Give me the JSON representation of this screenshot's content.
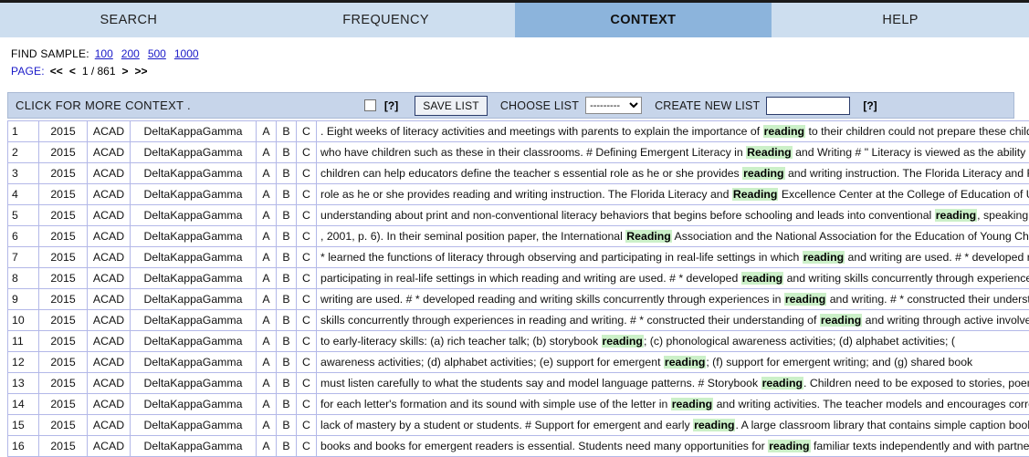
{
  "tabs": [
    {
      "label": "SEARCH",
      "active": false
    },
    {
      "label": "FREQUENCY",
      "active": false
    },
    {
      "label": "CONTEXT",
      "active": true
    },
    {
      "label": "HELP",
      "active": false
    }
  ],
  "nav": {
    "find_sample_label": "FIND SAMPLE:",
    "sample_links": [
      "100",
      "200",
      "500",
      "1000"
    ],
    "page_label": "PAGE:",
    "first_arrow": "<<",
    "prev_arrow": "<",
    "page_indicator": "1 / 861",
    "next_arrow": ">",
    "last_arrow": ">>"
  },
  "toolbar": {
    "title": "CLICK FOR MORE CONTEXT .",
    "checkbox_checked": false,
    "help_icon_1": "[?]",
    "save_list_label": "SAVE LIST",
    "choose_list_label": "CHOOSE LIST",
    "choose_list_value": "---------",
    "choose_list_options": [
      "---------"
    ],
    "create_new_list_label": "CREATE NEW LIST",
    "create_new_list_value": "",
    "create_new_list_placeholder": "",
    "help_icon_2": "[?]"
  },
  "colors": {
    "tab_inactive": "#cddeef",
    "tab_active": "#8cb4dc",
    "toolbar_bg": "#c7d5ea",
    "table_border": "#b3b8e8",
    "keyword_highlight": "#cbf0c8",
    "link_blue": "#1919c8"
  },
  "table": {
    "col_a_label": "A",
    "col_b_label": "B",
    "col_c_label": "C",
    "rows": [
      {
        "num": "1",
        "year": "2015",
        "genre": "ACAD",
        "source": "DeltaKappaGamma",
        "pre": ". Eight weeks of literacy activities and meetings with parents to explain the importance of ",
        "kw": "reading",
        "post": " to their children could not prepare these children for the complexities of the"
      },
      {
        "num": "2",
        "year": "2015",
        "genre": "ACAD",
        "source": "DeltaKappaGamma",
        "pre": "who have children such as these in their classrooms. # Defining Emergent Literacy in ",
        "kw": "Reading",
        "post": " and Writing # \" Literacy is viewed as the ability of individuals to construct meaning"
      },
      {
        "num": "3",
        "year": "2015",
        "genre": "ACAD",
        "source": "DeltaKappaGamma",
        "pre": "children can help educators define the teacher s essential role as he or she provides ",
        "kw": "reading",
        "post": " and writing instruction. The Florida Literacy and Reading Excellence Center at the"
      },
      {
        "num": "4",
        "year": "2015",
        "genre": "ACAD",
        "source": "DeltaKappaGamma",
        "pre": "role as he or she provides reading and writing instruction. The Florida Literacy and ",
        "kw": "Reading",
        "post": " Excellence Center at the College of Education of University of Central Florida"
      },
      {
        "num": "5",
        "year": "2015",
        "genre": "ACAD",
        "source": "DeltaKappaGamma",
        "pre": "understanding about print and non-conventional literacy behaviors that begins before schooling and leads into conventional ",
        "kw": "reading",
        "post": ", speaking, viewing, and the understanding of"
      },
      {
        "num": "6",
        "year": "2015",
        "genre": "ACAD",
        "source": "DeltaKappaGamma",
        "pre": ", 2001, p. 6). In their seminal position paper, the International ",
        "kw": "Reading",
        "post": " Association and the National Association for the Education of Young Children concluded that"
      },
      {
        "num": "7",
        "year": "2015",
        "genre": "ACAD",
        "source": "DeltaKappaGamma",
        "pre": "* learned the functions of literacy through observing and participating in real-life settings in which ",
        "kw": "reading",
        "post": " and writing are used. # * developed reading and writing skills"
      },
      {
        "num": "8",
        "year": "2015",
        "genre": "ACAD",
        "source": "DeltaKappaGamma",
        "pre": "participating in real-life settings in which reading and writing are used. # * developed ",
        "kw": "reading",
        "post": " and writing skills concurrently through experiences in reading and writing. # *"
      },
      {
        "num": "9",
        "year": "2015",
        "genre": "ACAD",
        "source": "DeltaKappaGamma",
        "pre": "writing are used. # * developed reading and writing skills concurrently through experiences in ",
        "kw": "reading",
        "post": " and writing. # * constructed their understanding of reading and writing"
      },
      {
        "num": "10",
        "year": "2015",
        "genre": "ACAD",
        "source": "DeltaKappaGamma",
        "pre": "skills concurrently through experiences in reading and writing. # * constructed their understanding of ",
        "kw": "reading",
        "post": " and writing through active involvement in various literacy"
      },
      {
        "num": "11",
        "year": "2015",
        "genre": "ACAD",
        "source": "DeltaKappaGamma",
        "pre": "to early-literacy skills: (a) rich teacher talk; (b) storybook ",
        "kw": "reading",
        "post": "; (c) phonological awareness activities; (d) alphabet activities; ("
      },
      {
        "num": "12",
        "year": "2015",
        "genre": "ACAD",
        "source": "DeltaKappaGamma",
        "pre": "awareness activities; (d) alphabet activities; (e) support for emergent ",
        "kw": "reading",
        "post": "; (f) support for emergent writing; and (g) shared book"
      },
      {
        "num": "13",
        "year": "2015",
        "genre": "ACAD",
        "source": "DeltaKappaGamma",
        "pre": "must listen carefully to what the students say and model language patterns. # Storybook ",
        "kw": "reading",
        "post": ". Children need to be exposed to stories, poems, and expository text"
      },
      {
        "num": "14",
        "year": "2015",
        "genre": "ACAD",
        "source": "DeltaKappaGamma",
        "pre": "for each letter's formation and its sound with simple use of the letter in ",
        "kw": "reading",
        "post": " and writing activities. The teacher models and encourages correct formation of letters"
      },
      {
        "num": "15",
        "year": "2015",
        "genre": "ACAD",
        "source": "DeltaKappaGamma",
        "pre": "lack of mastery by a student or students. # Support for emergent and early ",
        "kw": "reading",
        "post": ". A large classroom library that contains simple caption books and books for"
      },
      {
        "num": "16",
        "year": "2015",
        "genre": "ACAD",
        "source": "DeltaKappaGamma",
        "pre": "books and books for emergent readers is essential. Students need many opportunities for ",
        "kw": "reading",
        "post": " familiar texts independently and with partners"
      }
    ]
  }
}
